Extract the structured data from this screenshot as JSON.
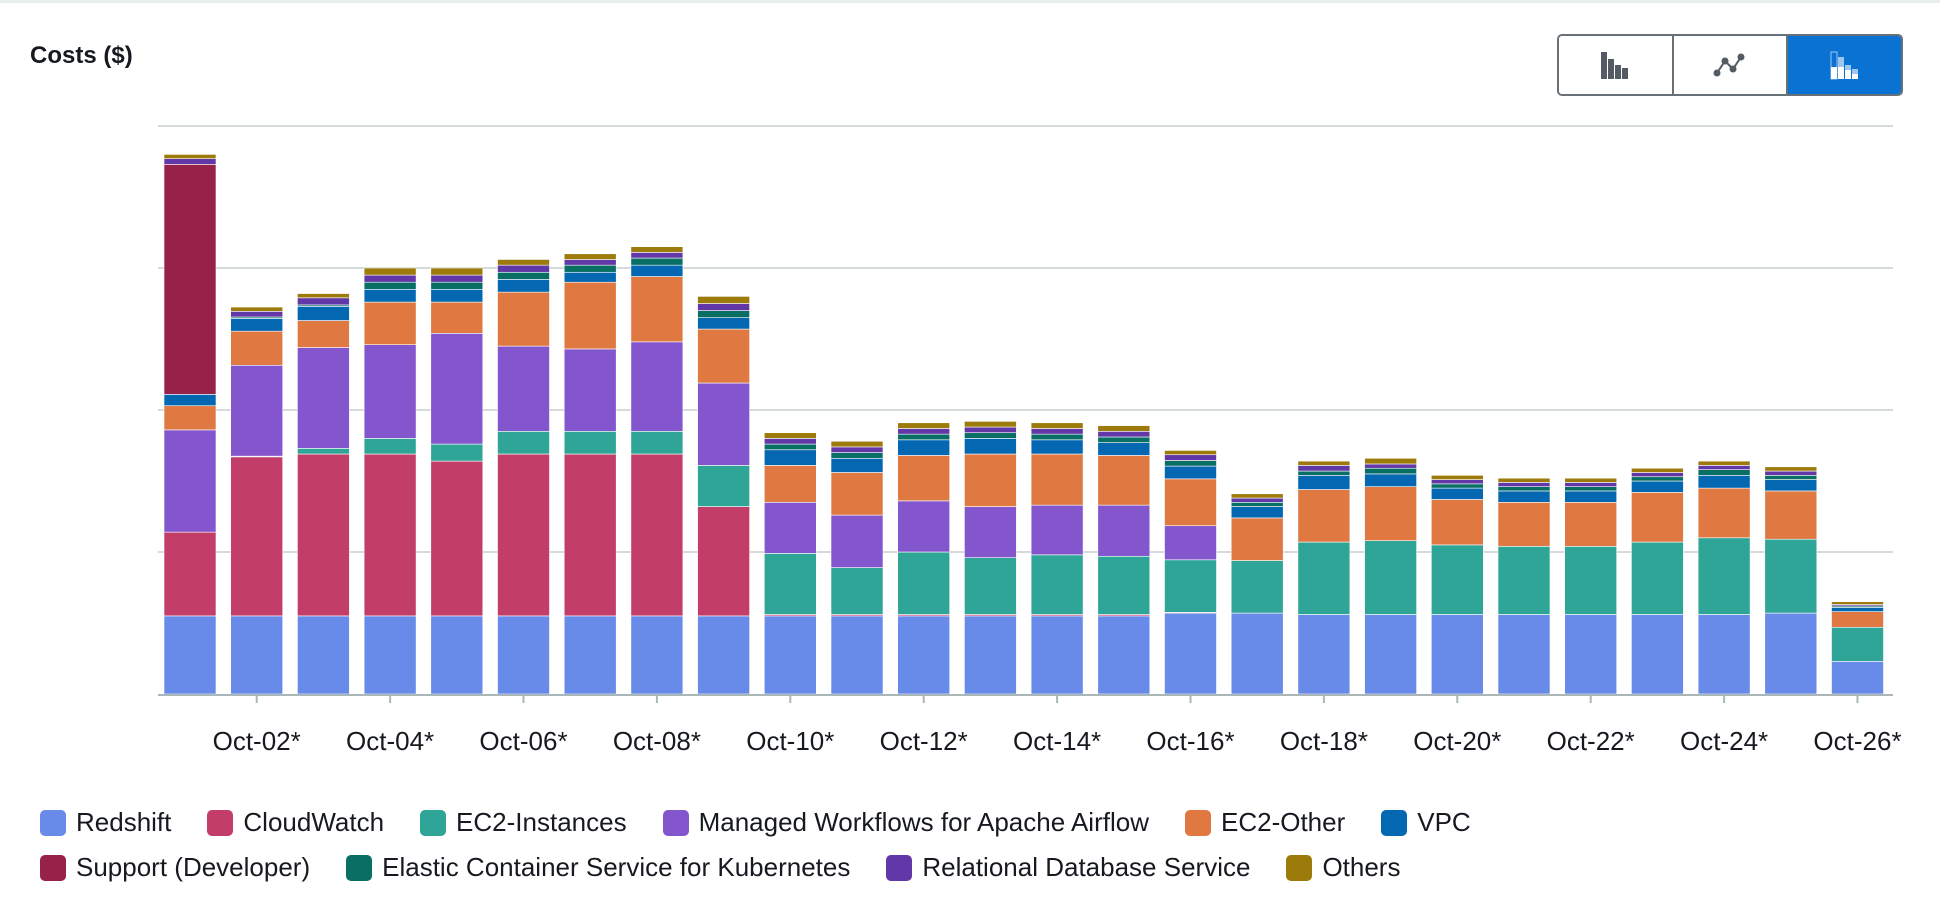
{
  "title": "Costs ($)",
  "toggle": [
    {
      "name": "bar-chart",
      "icon": "grouped-bar-icon",
      "active": false
    },
    {
      "name": "line-chart",
      "icon": "line-chart-icon",
      "active": false
    },
    {
      "name": "stacked-bar-chart",
      "icon": "stacked-bar-icon",
      "active": true
    }
  ],
  "colors": {
    "accent": "#0972d3"
  },
  "chart_data": {
    "type": "bar",
    "stacked": true,
    "title": "Costs ($)",
    "xlabel": "",
    "ylabel": "",
    "y_tick_labels_shown": false,
    "grid": true,
    "ylim": [
      0,
      400
    ],
    "legend_position": "bottom",
    "categories": [
      "Oct-01*",
      "Oct-02*",
      "Oct-03*",
      "Oct-04*",
      "Oct-05*",
      "Oct-06*",
      "Oct-07*",
      "Oct-08*",
      "Oct-09*",
      "Oct-10*",
      "Oct-11*",
      "Oct-12*",
      "Oct-13*",
      "Oct-14*",
      "Oct-15*",
      "Oct-16*",
      "Oct-17*",
      "Oct-18*",
      "Oct-19*",
      "Oct-20*",
      "Oct-21*",
      "Oct-22*",
      "Oct-23*",
      "Oct-24*",
      "Oct-25*",
      "Oct-26*"
    ],
    "x_tick_labels": [
      "Oct-02*",
      "Oct-04*",
      "Oct-06*",
      "Oct-08*",
      "Oct-10*",
      "Oct-12*",
      "Oct-14*",
      "Oct-16*",
      "Oct-18*",
      "Oct-20*",
      "Oct-22*",
      "Oct-24*",
      "Oct-26*"
    ],
    "series": [
      {
        "name": "Redshift",
        "color": "#688ae8",
        "values": [
          55,
          55,
          55,
          55,
          55,
          55,
          55,
          55,
          55,
          55,
          55,
          55,
          55,
          55,
          55,
          57,
          57,
          56,
          56,
          56,
          56,
          56,
          56,
          56,
          57,
          23
        ]
      },
      {
        "name": "CloudWatch",
        "color": "#c33d69",
        "values": [
          59,
          112,
          114,
          114,
          109,
          114,
          114,
          114,
          77,
          1,
          1,
          1,
          1,
          1,
          1,
          0.5,
          0,
          0,
          0,
          0,
          0,
          0,
          0,
          0,
          0,
          0
        ]
      },
      {
        "name": "EC2-Instances",
        "color": "#2ea597",
        "values": [
          0,
          0.5,
          4,
          11,
          12,
          16,
          16,
          16,
          29,
          43,
          33,
          44,
          40,
          42,
          41,
          37,
          37,
          51,
          52,
          49,
          48,
          48,
          51,
          54,
          52,
          24
        ]
      },
      {
        "name": "Managed Workflows for Apache Airflow",
        "color": "#8456ce",
        "values": [
          72,
          64,
          71,
          66,
          78,
          60,
          58,
          63,
          58,
          36,
          37,
          36,
          36,
          35,
          36,
          24,
          0,
          0,
          0,
          0,
          0,
          0,
          0,
          0,
          0,
          0
        ]
      },
      {
        "name": "EC2-Other",
        "color": "#e07941",
        "values": [
          17,
          24,
          19,
          30,
          22,
          38,
          47,
          46,
          38,
          26,
          30,
          32,
          37,
          36,
          35,
          33,
          30,
          37,
          38,
          32,
          31,
          31,
          35,
          35,
          34,
          11
        ]
      },
      {
        "name": "VPC",
        "color": "#0467b1",
        "values": [
          8,
          9,
          10,
          9,
          9,
          9,
          7,
          8,
          8,
          11,
          10,
          11,
          11,
          10,
          9,
          9,
          8,
          10,
          9,
          8,
          8,
          8,
          8,
          9,
          8,
          3
        ]
      },
      {
        "name": "Support (Developer)",
        "color": "#962249",
        "values": [
          162,
          0,
          0,
          0,
          0,
          0,
          0,
          0,
          0,
          0,
          0,
          0,
          0,
          0,
          0,
          0,
          0,
          0,
          0,
          0,
          0,
          0,
          0,
          0,
          0,
          0
        ]
      },
      {
        "name": "Elastic Container Service for Kubernetes",
        "color": "#096f64",
        "values": [
          0,
          1,
          1,
          5,
          5,
          5,
          5,
          5,
          5,
          4,
          4,
          4,
          4,
          4,
          4,
          4,
          3,
          3,
          4,
          3,
          3,
          3,
          3,
          4,
          3,
          1
        ]
      },
      {
        "name": "Relational Database Service",
        "color": "#6237a7",
        "values": [
          4,
          4,
          5,
          5,
          5,
          5,
          4,
          4,
          5,
          4,
          4,
          4,
          4,
          4,
          4,
          4,
          3,
          4,
          3,
          3,
          3,
          3,
          3,
          3,
          3,
          1
        ]
      },
      {
        "name": "Others",
        "color": "#9c7b0b",
        "values": [
          3,
          3,
          3,
          5,
          5,
          4,
          4,
          4,
          5,
          4,
          4,
          4,
          4,
          4,
          4,
          3,
          3,
          3,
          4,
          3,
          3,
          3,
          3,
          3,
          3,
          2
        ]
      }
    ]
  }
}
